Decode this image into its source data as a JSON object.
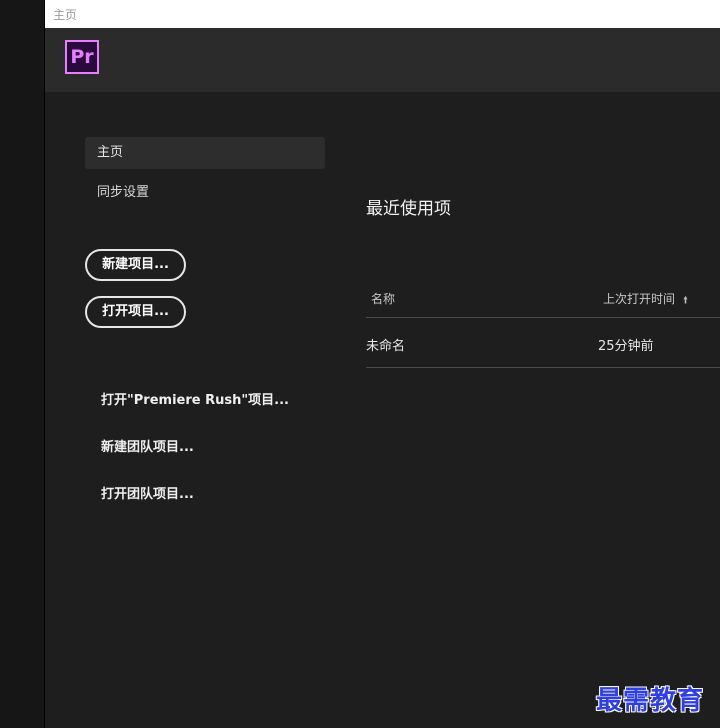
{
  "window": {
    "title": "主页"
  },
  "header": {
    "logo_text": "Pr",
    "brand_color": "#e77dff"
  },
  "nav": {
    "items": [
      {
        "label": "主页",
        "active": true
      },
      {
        "label": "同步设置",
        "active": false
      }
    ]
  },
  "actions": {
    "new_project": "新建项目...",
    "open_project": "打开项目..."
  },
  "links": {
    "open_rush": "打开\"Premiere Rush\"项目...",
    "new_team": "新建团队项目...",
    "open_team": "打开团队项目..."
  },
  "recent": {
    "title": "最近使用项",
    "columns": {
      "name": "名称",
      "last_opened": "上次打开时间"
    },
    "rows": [
      {
        "name": "未命名",
        "last_opened": "25分钟前"
      }
    ]
  },
  "watermark": "最需教育"
}
